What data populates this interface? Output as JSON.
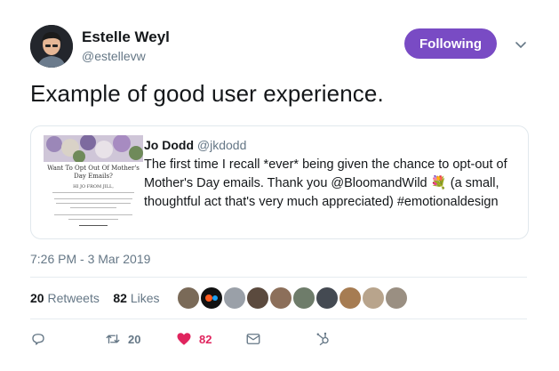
{
  "author": {
    "name": "Estelle Weyl",
    "handle": "@estellevw"
  },
  "follow_button": {
    "label": "Following"
  },
  "tweet": {
    "text": "Example of good user experience."
  },
  "quoted": {
    "name": "Jo Dodd",
    "handle": "@jkdodd",
    "text": "The first time I recall *ever* being given the chance to opt-out of Mother's Day emails. Thank you @BloomandWild 💐 (a small, thoughtful act that's very much appreciated) #emotionaldesign",
    "image": {
      "title": "Want To Opt Out Of Mother's Day Emails?",
      "subtitle": "HI JO FROM JILL,"
    }
  },
  "timestamp": "7:26 PM - 3 Mar 2019",
  "stats": {
    "retweets_count": "20",
    "retweets_label": "Retweets",
    "likes_count": "82",
    "likes_label": "Likes"
  },
  "actions": {
    "retweet_count": "20",
    "like_count": "82"
  },
  "colors": {
    "accent": "#794bc4",
    "like": "#e0245e",
    "muted": "#657786"
  }
}
